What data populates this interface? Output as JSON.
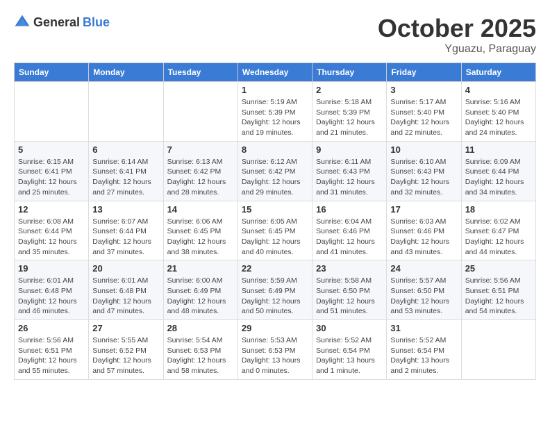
{
  "header": {
    "logo_general": "General",
    "logo_blue": "Blue",
    "month_title": "October 2025",
    "subtitle": "Yguazu, Paraguay"
  },
  "days_of_week": [
    "Sunday",
    "Monday",
    "Tuesday",
    "Wednesday",
    "Thursday",
    "Friday",
    "Saturday"
  ],
  "weeks": [
    [
      {
        "day": "",
        "info": ""
      },
      {
        "day": "",
        "info": ""
      },
      {
        "day": "",
        "info": ""
      },
      {
        "day": "1",
        "sunrise": "Sunrise: 5:19 AM",
        "sunset": "Sunset: 5:39 PM",
        "daylight": "Daylight: 12 hours and 19 minutes."
      },
      {
        "day": "2",
        "sunrise": "Sunrise: 5:18 AM",
        "sunset": "Sunset: 5:39 PM",
        "daylight": "Daylight: 12 hours and 21 minutes."
      },
      {
        "day": "3",
        "sunrise": "Sunrise: 5:17 AM",
        "sunset": "Sunset: 5:40 PM",
        "daylight": "Daylight: 12 hours and 22 minutes."
      },
      {
        "day": "4",
        "sunrise": "Sunrise: 5:16 AM",
        "sunset": "Sunset: 5:40 PM",
        "daylight": "Daylight: 12 hours and 24 minutes."
      }
    ],
    [
      {
        "day": "5",
        "sunrise": "Sunrise: 6:15 AM",
        "sunset": "Sunset: 6:41 PM",
        "daylight": "Daylight: 12 hours and 25 minutes."
      },
      {
        "day": "6",
        "sunrise": "Sunrise: 6:14 AM",
        "sunset": "Sunset: 6:41 PM",
        "daylight": "Daylight: 12 hours and 27 minutes."
      },
      {
        "day": "7",
        "sunrise": "Sunrise: 6:13 AM",
        "sunset": "Sunset: 6:42 PM",
        "daylight": "Daylight: 12 hours and 28 minutes."
      },
      {
        "day": "8",
        "sunrise": "Sunrise: 6:12 AM",
        "sunset": "Sunset: 6:42 PM",
        "daylight": "Daylight: 12 hours and 29 minutes."
      },
      {
        "day": "9",
        "sunrise": "Sunrise: 6:11 AM",
        "sunset": "Sunset: 6:43 PM",
        "daylight": "Daylight: 12 hours and 31 minutes."
      },
      {
        "day": "10",
        "sunrise": "Sunrise: 6:10 AM",
        "sunset": "Sunset: 6:43 PM",
        "daylight": "Daylight: 12 hours and 32 minutes."
      },
      {
        "day": "11",
        "sunrise": "Sunrise: 6:09 AM",
        "sunset": "Sunset: 6:44 PM",
        "daylight": "Daylight: 12 hours and 34 minutes."
      }
    ],
    [
      {
        "day": "12",
        "sunrise": "Sunrise: 6:08 AM",
        "sunset": "Sunset: 6:44 PM",
        "daylight": "Daylight: 12 hours and 35 minutes."
      },
      {
        "day": "13",
        "sunrise": "Sunrise: 6:07 AM",
        "sunset": "Sunset: 6:44 PM",
        "daylight": "Daylight: 12 hours and 37 minutes."
      },
      {
        "day": "14",
        "sunrise": "Sunrise: 6:06 AM",
        "sunset": "Sunset: 6:45 PM",
        "daylight": "Daylight: 12 hours and 38 minutes."
      },
      {
        "day": "15",
        "sunrise": "Sunrise: 6:05 AM",
        "sunset": "Sunset: 6:45 PM",
        "daylight": "Daylight: 12 hours and 40 minutes."
      },
      {
        "day": "16",
        "sunrise": "Sunrise: 6:04 AM",
        "sunset": "Sunset: 6:46 PM",
        "daylight": "Daylight: 12 hours and 41 minutes."
      },
      {
        "day": "17",
        "sunrise": "Sunrise: 6:03 AM",
        "sunset": "Sunset: 6:46 PM",
        "daylight": "Daylight: 12 hours and 43 minutes."
      },
      {
        "day": "18",
        "sunrise": "Sunrise: 6:02 AM",
        "sunset": "Sunset: 6:47 PM",
        "daylight": "Daylight: 12 hours and 44 minutes."
      }
    ],
    [
      {
        "day": "19",
        "sunrise": "Sunrise: 6:01 AM",
        "sunset": "Sunset: 6:48 PM",
        "daylight": "Daylight: 12 hours and 46 minutes."
      },
      {
        "day": "20",
        "sunrise": "Sunrise: 6:01 AM",
        "sunset": "Sunset: 6:48 PM",
        "daylight": "Daylight: 12 hours and 47 minutes."
      },
      {
        "day": "21",
        "sunrise": "Sunrise: 6:00 AM",
        "sunset": "Sunset: 6:49 PM",
        "daylight": "Daylight: 12 hours and 48 minutes."
      },
      {
        "day": "22",
        "sunrise": "Sunrise: 5:59 AM",
        "sunset": "Sunset: 6:49 PM",
        "daylight": "Daylight: 12 hours and 50 minutes."
      },
      {
        "day": "23",
        "sunrise": "Sunrise: 5:58 AM",
        "sunset": "Sunset: 6:50 PM",
        "daylight": "Daylight: 12 hours and 51 minutes."
      },
      {
        "day": "24",
        "sunrise": "Sunrise: 5:57 AM",
        "sunset": "Sunset: 6:50 PM",
        "daylight": "Daylight: 12 hours and 53 minutes."
      },
      {
        "day": "25",
        "sunrise": "Sunrise: 5:56 AM",
        "sunset": "Sunset: 6:51 PM",
        "daylight": "Daylight: 12 hours and 54 minutes."
      }
    ],
    [
      {
        "day": "26",
        "sunrise": "Sunrise: 5:56 AM",
        "sunset": "Sunset: 6:51 PM",
        "daylight": "Daylight: 12 hours and 55 minutes."
      },
      {
        "day": "27",
        "sunrise": "Sunrise: 5:55 AM",
        "sunset": "Sunset: 6:52 PM",
        "daylight": "Daylight: 12 hours and 57 minutes."
      },
      {
        "day": "28",
        "sunrise": "Sunrise: 5:54 AM",
        "sunset": "Sunset: 6:53 PM",
        "daylight": "Daylight: 12 hours and 58 minutes."
      },
      {
        "day": "29",
        "sunrise": "Sunrise: 5:53 AM",
        "sunset": "Sunset: 6:53 PM",
        "daylight": "Daylight: 13 hours and 0 minutes."
      },
      {
        "day": "30",
        "sunrise": "Sunrise: 5:52 AM",
        "sunset": "Sunset: 6:54 PM",
        "daylight": "Daylight: 13 hours and 1 minute."
      },
      {
        "day": "31",
        "sunrise": "Sunrise: 5:52 AM",
        "sunset": "Sunset: 6:54 PM",
        "daylight": "Daylight: 13 hours and 2 minutes."
      },
      {
        "day": "",
        "info": ""
      }
    ]
  ]
}
